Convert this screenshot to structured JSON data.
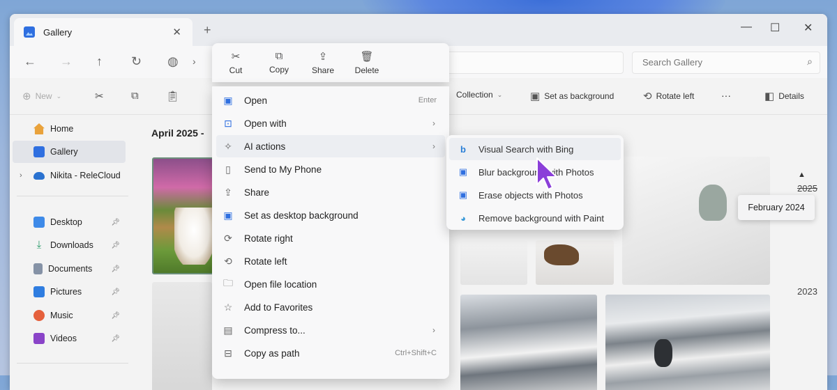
{
  "window": {
    "tab_title": "Gallery",
    "tab_close": "✕",
    "new_tab": "+",
    "minimize": "—",
    "maximize": "☐",
    "close": "✕"
  },
  "address": {
    "search_placeholder": "Search Gallery"
  },
  "toolbar": {
    "new_label": "New",
    "collection_label": "Collection",
    "set_background_label": "Set as background",
    "rotate_left_label": "Rotate left",
    "more_label": "···",
    "details_label": "Details"
  },
  "sidebar": {
    "items": [
      {
        "label": "Home"
      },
      {
        "label": "Gallery"
      },
      {
        "label": "Nikita - ReleCloud"
      },
      {
        "label": "Desktop"
      },
      {
        "label": "Downloads"
      },
      {
        "label": "Documents"
      },
      {
        "label": "Pictures"
      },
      {
        "label": "Music"
      },
      {
        "label": "Videos"
      }
    ]
  },
  "content": {
    "date_header": "April 2025 -",
    "timeline": [
      "2025",
      "2023"
    ]
  },
  "context_menu": {
    "quick_actions": [
      {
        "label": "Cut",
        "icon": "scissors-icon"
      },
      {
        "label": "Copy",
        "icon": "copy-icon"
      },
      {
        "label": "Share",
        "icon": "share-icon"
      },
      {
        "label": "Delete",
        "icon": "trash-icon"
      }
    ],
    "items": [
      {
        "label": "Open",
        "shortcut": "Enter"
      },
      {
        "label": "Open with"
      },
      {
        "label": "AI actions"
      },
      {
        "label": "Send to My Phone"
      },
      {
        "label": "Share"
      },
      {
        "label": "Set as desktop background"
      },
      {
        "label": "Rotate right"
      },
      {
        "label": "Rotate left"
      },
      {
        "label": "Open file location"
      },
      {
        "label": "Add to Favorites"
      },
      {
        "label": "Compress to..."
      },
      {
        "label": "Copy as path",
        "shortcut": "Ctrl+Shift+C"
      }
    ]
  },
  "submenu": {
    "items": [
      {
        "label": "Visual Search with Bing"
      },
      {
        "label": "Blur background with Photos"
      },
      {
        "label": "Erase objects with Photos"
      },
      {
        "label": "Remove background with Paint"
      }
    ]
  },
  "tooltip": {
    "text": "February 2024"
  },
  "colors": {
    "accent": "#2f6fe0",
    "menu_bg": "#f8f8f9",
    "hover_bg": "#eceef2"
  }
}
